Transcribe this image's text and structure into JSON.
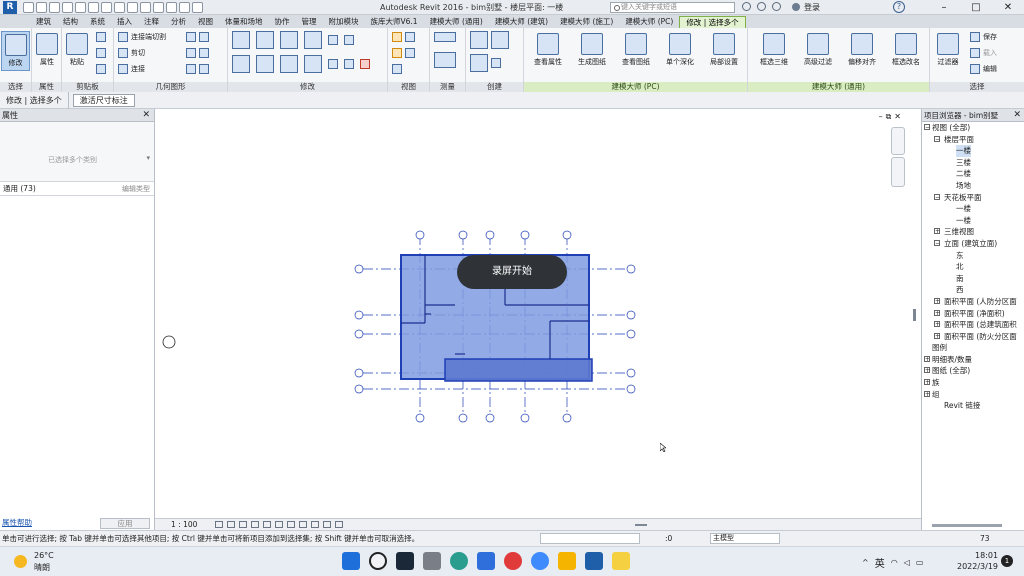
{
  "titlebar": {
    "title": "Autodesk Revit 2016 -    bim别墅 - 楼层平面: 一楼",
    "search_placeholder": "键入关键字或短语",
    "login": "登录",
    "help": "?",
    "minimize": "–",
    "maximize": "□",
    "close": "✕"
  },
  "tabs": [
    {
      "label": "建筑"
    },
    {
      "label": "结构"
    },
    {
      "label": "系统"
    },
    {
      "label": "插入"
    },
    {
      "label": "注释"
    },
    {
      "label": "分析"
    },
    {
      "label": "视图"
    },
    {
      "label": "体量和场地"
    },
    {
      "label": "协作"
    },
    {
      "label": "管理"
    },
    {
      "label": "附加模块"
    },
    {
      "label": "族库大师V6.1"
    },
    {
      "label": "建模大师 (通用)"
    },
    {
      "label": "建模大师 (建筑)"
    },
    {
      "label": "建模大师 (施工)"
    },
    {
      "label": "建模大师 (PC)"
    },
    {
      "label": "修改 | 选择多个"
    }
  ],
  "ribbon": {
    "select": {
      "label": "选择",
      "modify": "修改"
    },
    "properties": {
      "label": "属性",
      "btn": "属性"
    },
    "clipboard": {
      "label": "剪贴板",
      "paste": "粘贴"
    },
    "geometry": {
      "label": "几何图形",
      "join": "连接端切割",
      "cut": "剪切",
      "connect": "连接"
    },
    "modify": {
      "label": "修改"
    },
    "view": {
      "label": "视图"
    },
    "measure": {
      "label": "测量"
    },
    "create": {
      "label": "创建"
    },
    "pc": {
      "label": "建模大师 (PC)",
      "b1": "查看属性",
      "b2": "生成图纸",
      "b3": "查看图纸",
      "b4": "单个深化",
      "b5": "局部设置"
    },
    "general": {
      "label": "建模大师 (通用)",
      "b1": "框选三维",
      "b2": "高级过滤",
      "b3": "偏移对齐",
      "b4": "框选改名"
    },
    "selection": {
      "label": "选择",
      "filter": "过滤器",
      "save": "保存",
      "load": "载入",
      "edit": "编辑"
    }
  },
  "context_bar": {
    "mode": "修改 | 选择多个",
    "option": "激活尺寸标注"
  },
  "properties_panel": {
    "title": "属性",
    "type_text": "已选择多个类别",
    "filter_text": "通用 (73)",
    "edit_type": "编辑类型",
    "help": "属性帮助",
    "apply": "应用"
  },
  "canvas": {
    "overlay": "录屏开始"
  },
  "viewbar": {
    "scale": "1 : 100"
  },
  "browser": {
    "title": "项目浏览器 - bim别墅",
    "items": [
      {
        "label": "视图 (全部)",
        "expander": "−"
      },
      {
        "label": "楼层平面",
        "expander": "−"
      },
      {
        "label": "一楼",
        "expander": ""
      },
      {
        "label": "三楼",
        "expander": ""
      },
      {
        "label": "二楼",
        "expander": ""
      },
      {
        "label": "场地",
        "expander": ""
      },
      {
        "label": "天花板平面",
        "expander": "−"
      },
      {
        "label": "一楼",
        "expander": ""
      },
      {
        "label": "一楼",
        "expander": ""
      },
      {
        "label": "三维视图",
        "expander": "+"
      },
      {
        "label": "立面 (建筑立面)",
        "expander": "−"
      },
      {
        "label": "东",
        "expander": ""
      },
      {
        "label": "北",
        "expander": ""
      },
      {
        "label": "南",
        "expander": ""
      },
      {
        "label": "西",
        "expander": ""
      },
      {
        "label": "面积平面 (人防分区面",
        "expander": "+"
      },
      {
        "label": "面积平面 (净面积)",
        "expander": "+"
      },
      {
        "label": "面积平面 (总建筑面积",
        "expander": "+"
      },
      {
        "label": "面积平面 (防火分区面",
        "expander": "+"
      },
      {
        "label": "图例",
        "expander": ""
      },
      {
        "label": "明细表/数量",
        "expander": "+"
      },
      {
        "label": "图纸 (全部)",
        "expander": "+"
      },
      {
        "label": "族",
        "expander": "+"
      },
      {
        "label": "组",
        "expander": "+"
      },
      {
        "label": "Revit 链接",
        "expander": ""
      }
    ]
  },
  "statusbar": {
    "text": "单击可进行选择; 按 Tab 键并单击可选择其他项目; 按 Ctrl 键并单击可将新项目添加到选择集; 按 Shift 键并单击可取消选择。",
    "zero": ":0",
    "model": "主模型",
    "filter_count": "73"
  },
  "taskbar": {
    "temp": "26°C",
    "weather": "晴朗",
    "ime": "英",
    "time": "18:01",
    "date": "2022/3/19",
    "notif": "1"
  },
  "colors": {
    "selection_fill": "#7f9be0",
    "selection_stroke": "#1f3fb5",
    "grid_line": "#1f3fb5",
    "overlay": "#2f3338",
    "accent": "#1f5ea8"
  }
}
